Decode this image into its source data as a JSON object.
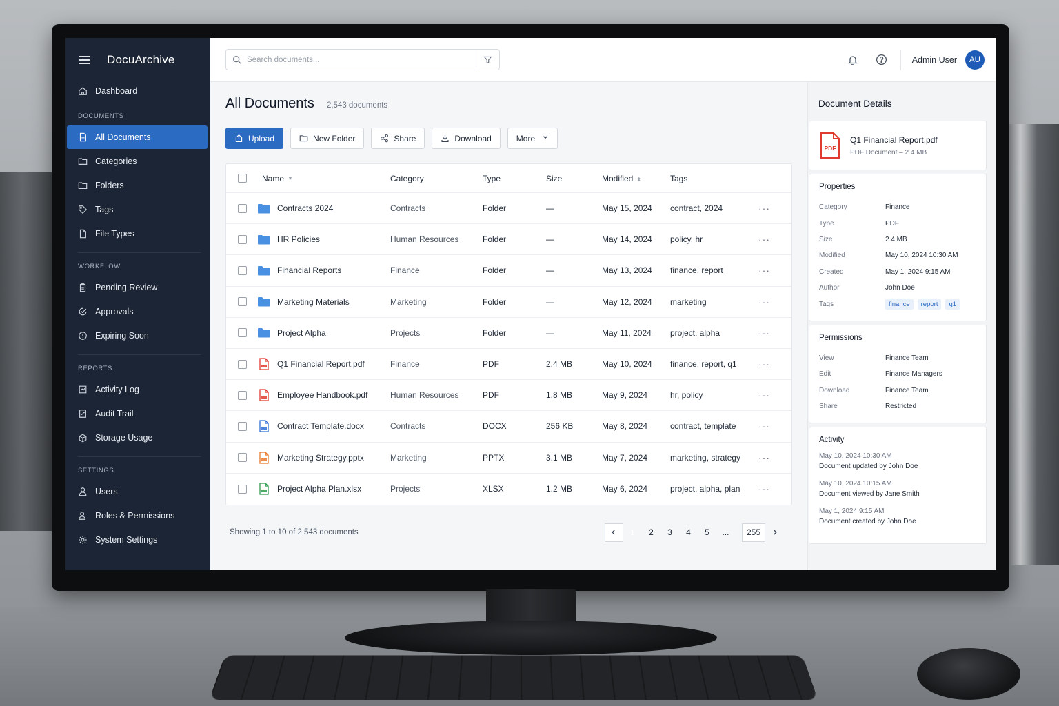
{
  "app": {
    "title": "DocuArchive"
  },
  "sidebar": {
    "dashboard": "Dashboard",
    "sections": [
      {
        "label": "DOCUMENTS",
        "items": [
          {
            "label": "All Documents",
            "icon": "document-icon",
            "active": true
          },
          {
            "label": "Categories",
            "icon": "folder-icon"
          },
          {
            "label": "Folders",
            "icon": "folder-icon"
          },
          {
            "label": "Tags",
            "icon": "tag-icon"
          },
          {
            "label": "File Types",
            "icon": "file-icon"
          }
        ]
      },
      {
        "label": "WORKFLOW",
        "items": [
          {
            "label": "Pending Review",
            "icon": "clipboard-icon"
          },
          {
            "label": "Approvals",
            "icon": "check-circle-icon"
          },
          {
            "label": "Expiring Soon",
            "icon": "alert-circle-icon"
          }
        ]
      },
      {
        "label": "REPORTS",
        "items": [
          {
            "label": "Activity Log",
            "icon": "activity-icon"
          },
          {
            "label": "Audit Trail",
            "icon": "audit-icon"
          },
          {
            "label": "Storage Usage",
            "icon": "database-icon"
          }
        ]
      },
      {
        "label": "SETTINGS",
        "items": [
          {
            "label": "Users",
            "icon": "user-icon"
          },
          {
            "label": "Roles & Permissions",
            "icon": "users-icon"
          },
          {
            "label": "System Settings",
            "icon": "gear-icon"
          }
        ]
      }
    ]
  },
  "topbar": {
    "search_placeholder": "Search documents...",
    "user_name": "Admin User",
    "avatar_initials": "AU"
  },
  "main": {
    "title": "All Documents",
    "count": "2,543 documents",
    "toolbar": {
      "upload": "Upload",
      "new_folder": "New Folder",
      "share": "Share",
      "download": "Download",
      "more": "More"
    },
    "columns": [
      "Name",
      "Category",
      "Type",
      "Size",
      "Modified",
      "Tags"
    ],
    "rows": [
      {
        "name": "Contracts 2024",
        "category": "Contracts",
        "type": "Folder",
        "size": "—",
        "modified": "May 15, 2024",
        "tags": "contract, 2024",
        "kind": "folder"
      },
      {
        "name": "HR Policies",
        "category": "Human Resources",
        "type": "Folder",
        "size": "—",
        "modified": "May 14, 2024",
        "tags": "policy, hr",
        "kind": "folder"
      },
      {
        "name": "Financial Reports",
        "category": "Finance",
        "type": "Folder",
        "size": "—",
        "modified": "May 13, 2024",
        "tags": "finance, report",
        "kind": "folder"
      },
      {
        "name": "Marketing Materials",
        "category": "Marketing",
        "type": "Folder",
        "size": "—",
        "modified": "May 12, 2024",
        "tags": "marketing",
        "kind": "folder"
      },
      {
        "name": "Project Alpha",
        "category": "Projects",
        "type": "Folder",
        "size": "—",
        "modified": "May 11, 2024",
        "tags": "project, alpha",
        "kind": "folder"
      },
      {
        "name": "Q1 Financial Report.pdf",
        "category": "Finance",
        "type": "PDF",
        "size": "2.4 MB",
        "modified": "May 10, 2024",
        "tags": "finance, report, q1",
        "kind": "pdf"
      },
      {
        "name": "Employee Handbook.pdf",
        "category": "Human Resources",
        "type": "PDF",
        "size": "1.8 MB",
        "modified": "May 9, 2024",
        "tags": "hr, policy",
        "kind": "pdf"
      },
      {
        "name": "Contract Template.docx",
        "category": "Contracts",
        "type": "DOCX",
        "size": "256 KB",
        "modified": "May 8, 2024",
        "tags": "contract, template",
        "kind": "docx"
      },
      {
        "name": "Marketing Strategy.pptx",
        "category": "Marketing",
        "type": "PPTX",
        "size": "3.1 MB",
        "modified": "May 7, 2024",
        "tags": "marketing, strategy",
        "kind": "pptx"
      },
      {
        "name": "Project Alpha Plan.xlsx",
        "category": "Projects",
        "type": "XLSX",
        "size": "1.2 MB",
        "modified": "May 6, 2024",
        "tags": "project, alpha, plan",
        "kind": "xlsx"
      }
    ],
    "showing": "Showing 1 to 10 of 2,543 documents",
    "pagination": {
      "pages": [
        "1",
        "2",
        "3",
        "4",
        "5"
      ],
      "ellipsis": "...",
      "last": "255",
      "current": "1"
    }
  },
  "details": {
    "title": "Document Details",
    "file": {
      "name": "Q1 Financial Report.pdf",
      "meta": "PDF Document – 2.4 MB",
      "badge": "PDF"
    },
    "properties": {
      "heading": "Properties",
      "items": [
        {
          "k": "Category",
          "v": "Finance"
        },
        {
          "k": "Type",
          "v": "PDF"
        },
        {
          "k": "Size",
          "v": "2.4 MB"
        },
        {
          "k": "Modified",
          "v": "May 10, 2024 10:30 AM"
        },
        {
          "k": "Created",
          "v": "May 1, 2024 9:15 AM"
        },
        {
          "k": "Author",
          "v": "John Doe"
        }
      ],
      "tags_label": "Tags",
      "tags": [
        "finance",
        "report",
        "q1"
      ]
    },
    "permissions": {
      "heading": "Permissions",
      "items": [
        {
          "k": "View",
          "v": "Finance Team"
        },
        {
          "k": "Edit",
          "v": "Finance Managers"
        },
        {
          "k": "Download",
          "v": "Finance Team"
        },
        {
          "k": "Share",
          "v": "Restricted"
        }
      ]
    },
    "activity": {
      "heading": "Activity",
      "items": [
        {
          "time": "May 10, 2024 10:30 AM",
          "text": "Document updated by John Doe"
        },
        {
          "time": "May 10, 2024 10:15 AM",
          "text": "Document viewed by Jane Smith"
        },
        {
          "time": "May 1, 2024 9:15 AM",
          "text": "Document created by John Doe"
        }
      ]
    }
  },
  "colors": {
    "accent": "#2c6bc2",
    "sidebar": "#1b2535",
    "folder": "#4a90e2",
    "pdf": "#e03b2f",
    "docx": "#2f6fd6",
    "pptx": "#e8782a",
    "xlsx": "#2e9a4b"
  }
}
